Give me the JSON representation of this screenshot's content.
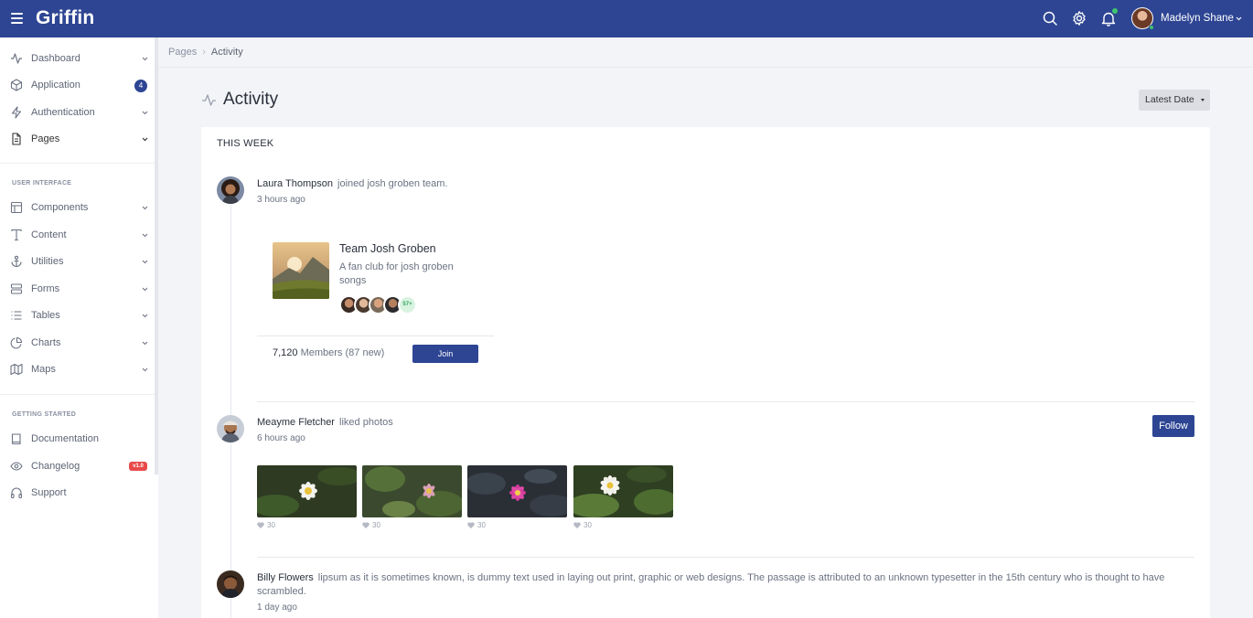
{
  "header": {
    "brand": "Griffin",
    "user_name": "Madelyn Shane",
    "icons": [
      "menu-icon",
      "search-icon",
      "gear-icon",
      "bell-icon"
    ]
  },
  "sidebar": {
    "items": [
      {
        "label": "Dashboard"
      },
      {
        "label": "Application",
        "badge": "4"
      },
      {
        "label": "Authentication"
      },
      {
        "label": "Pages"
      }
    ],
    "section_ui": "USER INTERFACE",
    "ui_items": [
      {
        "label": "Components"
      },
      {
        "label": "Content"
      },
      {
        "label": "Utilities"
      },
      {
        "label": "Forms"
      },
      {
        "label": "Tables"
      },
      {
        "label": "Charts"
      },
      {
        "label": "Maps"
      }
    ],
    "section_started": "GETTING STARTED",
    "started_items": [
      {
        "label": "Documentation"
      },
      {
        "label": "Changelog",
        "badge": "v1.0"
      },
      {
        "label": "Support"
      }
    ]
  },
  "breadcrumb": {
    "parent": "Pages",
    "separator": "›",
    "current": "Activity"
  },
  "page": {
    "title": "Activity",
    "sort_button": "Latest Date"
  },
  "feed": {
    "period_title": "THIS WEEK",
    "entries": [
      {
        "name": "Laura Thompson",
        "action": "joined josh groben team.",
        "time": "3 hours ago"
      },
      {
        "name": "Meayme Fletcher",
        "action": "liked photos",
        "time": "6 hours ago",
        "follow_label": "Follow"
      },
      {
        "name": "Billy Flowers",
        "action": "lipsum as it is sometimes known, is dummy text used in laying out print, graphic or web designs. The passage is attributed to an unknown typesetter in the 15th century who is thought to have scrambled.",
        "time": "1 day ago"
      }
    ],
    "team": {
      "name": "Team Josh Groben",
      "description": "A fan club for josh groben songs",
      "more_members": "57+",
      "members_count": "7,120",
      "members_label": "Members (87 new)",
      "join_label": "Join"
    },
    "photos": [
      {
        "likes": "30"
      },
      {
        "likes": "30"
      },
      {
        "likes": "30"
      },
      {
        "likes": "30"
      }
    ]
  }
}
